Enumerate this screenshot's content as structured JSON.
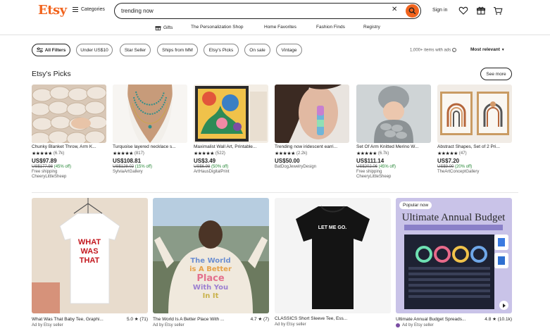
{
  "header": {
    "logo": "Etsy",
    "categories_label": "Categories",
    "search_value": "trending now",
    "sign_in": "Sign in"
  },
  "nav": {
    "items": [
      "Gifts",
      "The Personalization Shop",
      "Home Favorites",
      "Fashion Finds",
      "Registry"
    ]
  },
  "filters": {
    "all_filters": "All Filters",
    "chips": [
      "Under US$10",
      "Star Seller",
      "Ships from MM",
      "Etsy's Picks",
      "On sale",
      "Vintage"
    ],
    "item_count": "1,000+ items with ads",
    "sort": "Most relevant"
  },
  "picks": {
    "title": "Etsy's Picks",
    "see_more": "See more",
    "items": [
      {
        "title": "Chunky Blanket Throw, Arm K...",
        "stars": "★★★★★",
        "count": "(6.7k)",
        "price": "US$97.89",
        "orig": "US$177.98",
        "discount": "(45% off)",
        "ship": "Free shipping",
        "shop": "CheeryLittleSheep"
      },
      {
        "title": "Turquoise layered necklace s...",
        "stars": "★★★★★",
        "count": "(817)",
        "price": "US$108.81",
        "orig": "US$128.02",
        "discount": "(15% off)",
        "ship": "",
        "shop": "SylviaArtGallery"
      },
      {
        "title": "Maximalist Wall Art, Printable...",
        "stars": "★★★★★",
        "count": "(522)",
        "price": "US$3.49",
        "orig": "US$6.98",
        "discount": "(50% off)",
        "ship": "",
        "shop": "ArtHausDigitalPrint"
      },
      {
        "title": "Trending now iridescent earri...",
        "stars": "★★★★★",
        "count": "(2.2k)",
        "price": "US$50.00",
        "orig": "",
        "discount": "",
        "ship": "",
        "shop": "BatDogJewelryDesign"
      },
      {
        "title": "Set Of Arm Knitted Merino W...",
        "stars": "★★★★★",
        "count": "(6.7k)",
        "price": "US$111.14",
        "orig": "US$202.06",
        "discount": "(45% off)",
        "ship": "Free shipping",
        "shop": "CheeryLittleSheep"
      },
      {
        "title": "Abstract Shapes, Set of 2 Pri...",
        "stars": "★★★★★",
        "count": "(47)",
        "price": "US$7.20",
        "orig": "US$9.00",
        "discount": "(20% off)",
        "ship": "",
        "shop": "TheArtConceptGallery"
      }
    ]
  },
  "ads": [
    {
      "title": "What Was That Baby Tee, Graphi...",
      "rating": "5.0 ★ (71)",
      "adby": "Ad by Etsy seller",
      "shirt_text": [
        "WHAT",
        "WAS",
        "THAT"
      ]
    },
    {
      "title": "The World Is A Better Place With ...",
      "rating": "4.7 ★ (7)",
      "adby": "Ad by Etsy seller",
      "shirt_text": [
        "The World",
        "is A Better",
        "Place",
        "With You",
        "In It"
      ]
    },
    {
      "title": "CLASSICS Short Sleeve Tee, Ess...",
      "rating": "",
      "adby": "Ad by Etsy seller",
      "shirt_text": [
        "LET ME GO."
      ]
    },
    {
      "title": "Ultimate Annual Budget Spreads...",
      "rating": "4.8 ★ (10.1k)",
      "adby": "Ad by Etsy seller",
      "badge": "Popular now",
      "banner": "Ultimate Annual Budget"
    }
  ],
  "colors": {
    "brand": "#f1641e",
    "discount": "#258635"
  }
}
